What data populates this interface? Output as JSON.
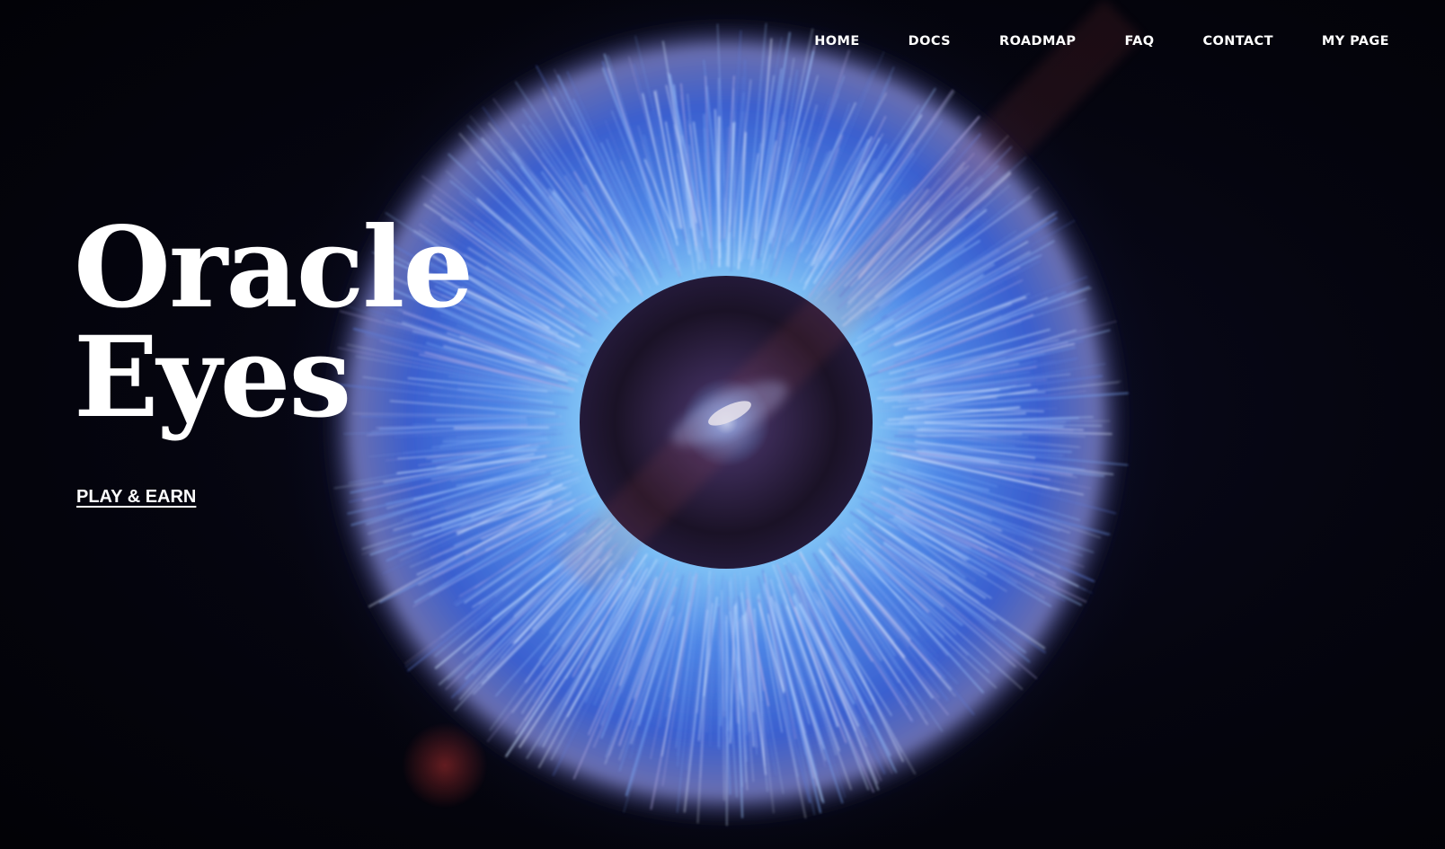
{
  "nav": {
    "items": [
      {
        "label": "HOME"
      },
      {
        "label": "DOCS"
      },
      {
        "label": "ROADMAP"
      },
      {
        "label": "FAQ"
      },
      {
        "label": "CONTACT"
      },
      {
        "label": "MY PAGE"
      }
    ]
  },
  "hero": {
    "title_line1": "Oracle",
    "title_line2": "Eyes",
    "cta_label": "PLAY & EARN"
  },
  "colors": {
    "background": "#030309",
    "iris_outer": "#3a5fcf",
    "iris_inner": "#8fd2ff",
    "text": "#ffffff"
  }
}
